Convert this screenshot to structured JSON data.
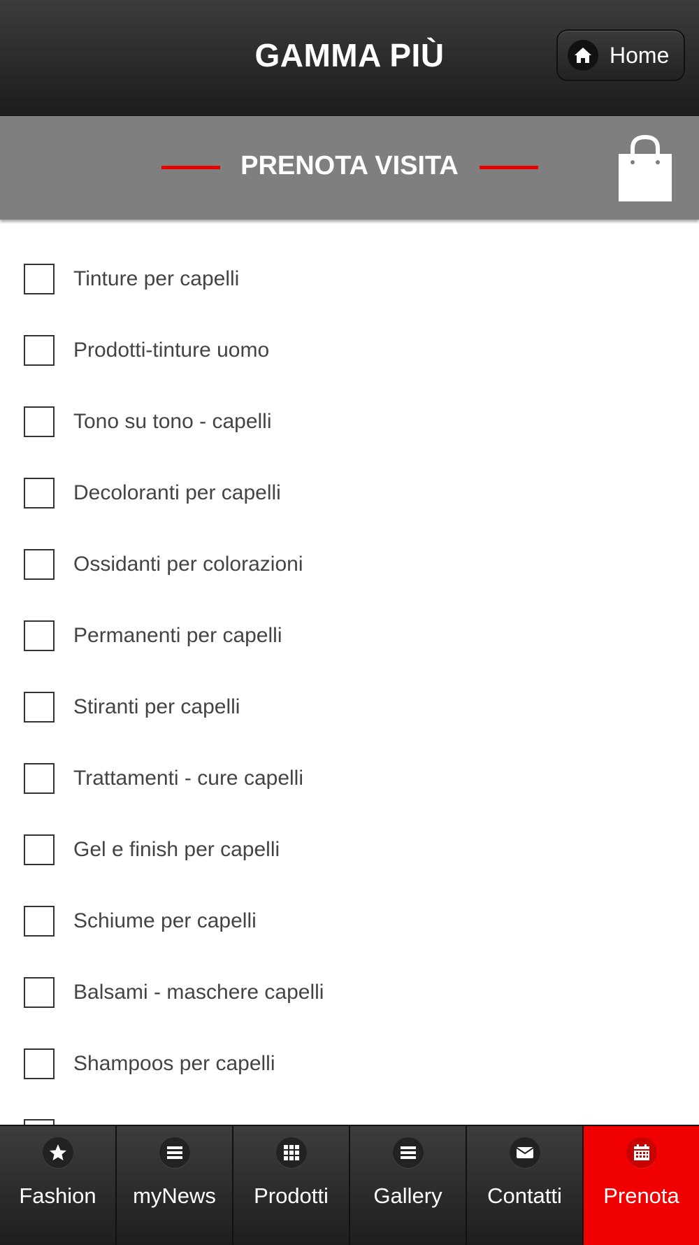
{
  "header": {
    "title": "GAMMA PIÙ",
    "home_label": "Home"
  },
  "section": {
    "title": "PRENOTA VISITA",
    "accent_color": "#e60000",
    "icon": "shopping-bag-icon"
  },
  "items": [
    {
      "label": "Tinture per capelli",
      "checked": false
    },
    {
      "label": "Prodotti-tinture uomo",
      "checked": false
    },
    {
      "label": "Tono su tono - capelli",
      "checked": false
    },
    {
      "label": "Decoloranti per capelli",
      "checked": false
    },
    {
      "label": "Ossidanti per colorazioni",
      "checked": false
    },
    {
      "label": "Permanenti per capelli",
      "checked": false
    },
    {
      "label": "Stiranti per capelli",
      "checked": false
    },
    {
      "label": "Trattamenti - cure capelli",
      "checked": false
    },
    {
      "label": "Gel e finish per capelli",
      "checked": false
    },
    {
      "label": "Schiume per capelli",
      "checked": false
    },
    {
      "label": "Balsami - maschere capelli",
      "checked": false
    },
    {
      "label": "Shampoos per capelli",
      "checked": false
    }
  ],
  "tabs": [
    {
      "label": "Fashion",
      "icon": "star-icon",
      "active": false
    },
    {
      "label": "myNews",
      "icon": "list-icon",
      "active": false
    },
    {
      "label": "Prodotti",
      "icon": "grid-icon",
      "active": false
    },
    {
      "label": "Gallery",
      "icon": "list-icon",
      "active": false
    },
    {
      "label": "Contatti",
      "icon": "envelope-icon",
      "active": false
    },
    {
      "label": "Prenota",
      "icon": "calendar-icon",
      "active": true
    }
  ],
  "colors": {
    "active_tab": "#f00000",
    "section_bar": "#7f7f7f"
  }
}
